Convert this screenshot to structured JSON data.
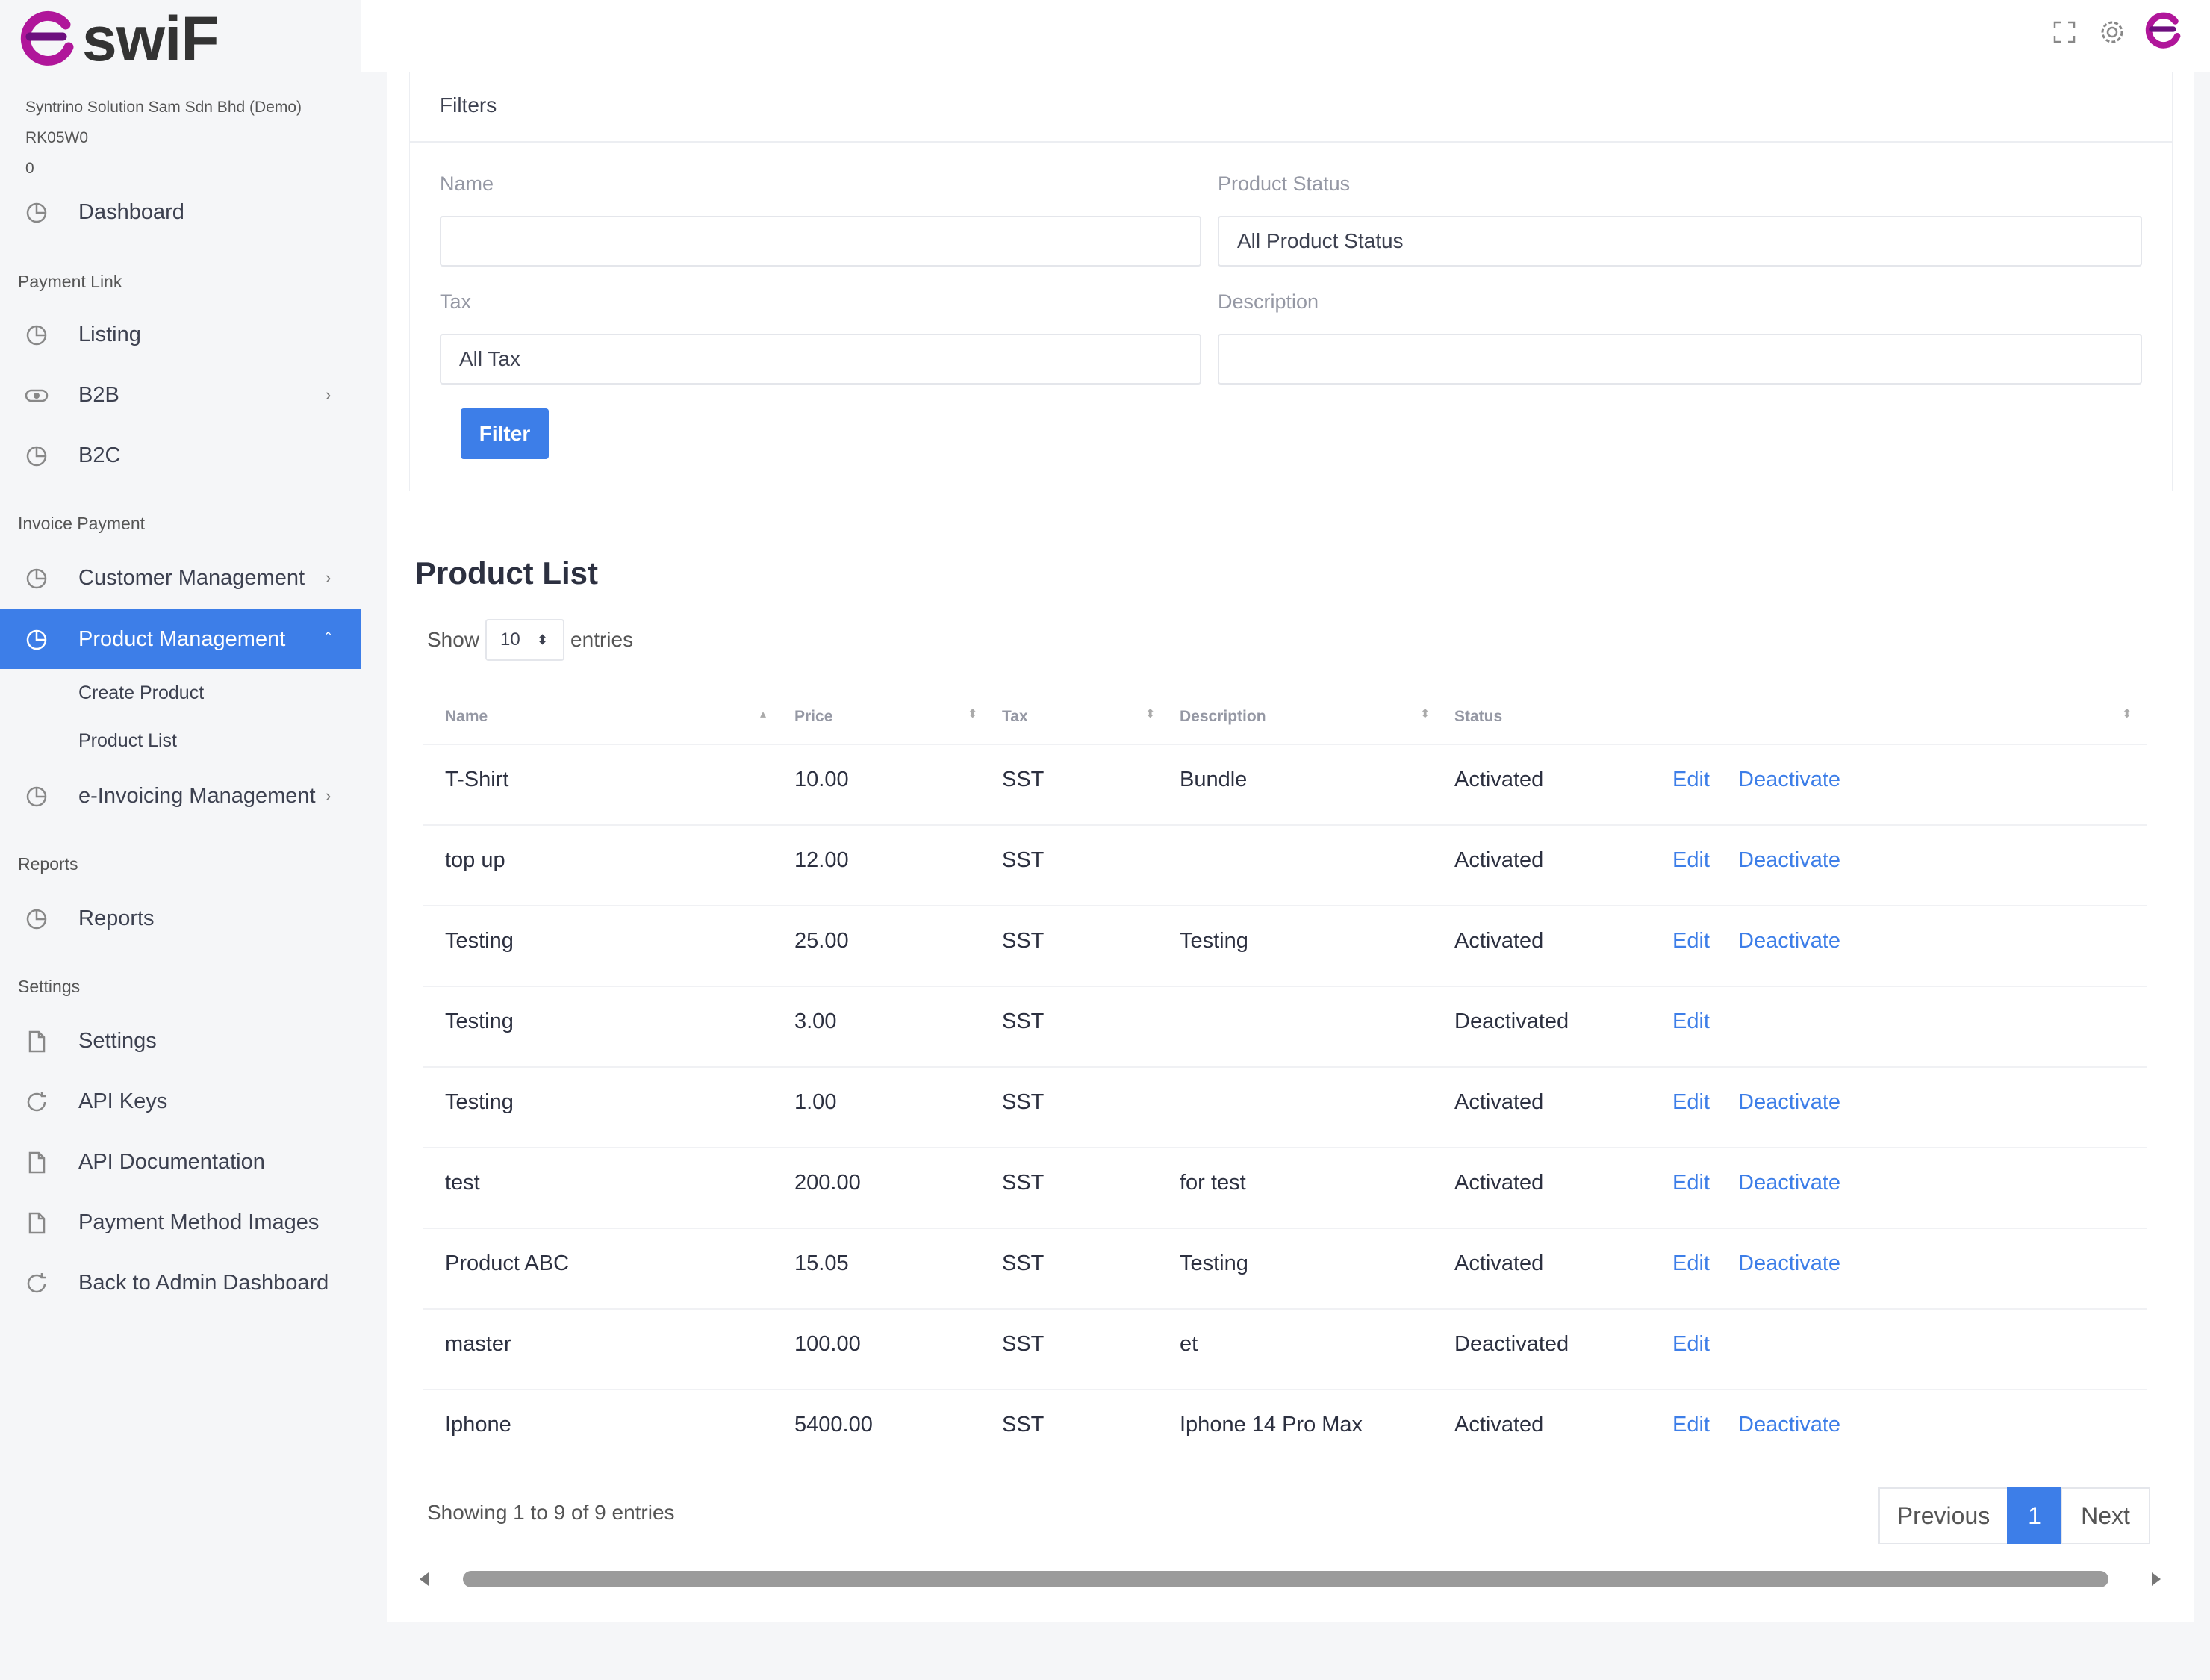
{
  "brand": {
    "name": "swiF",
    "accent": "#3d7ee8",
    "logo_color": "#b0169a"
  },
  "company": {
    "name": "Syntrino Solution Sam Sdn Bhd (Demo)",
    "code": "RK05W0",
    "balance": "0"
  },
  "sidebar": {
    "dashboard": "Dashboard",
    "sections": {
      "payment_link": "Payment Link",
      "invoice_payment": "Invoice Payment",
      "reports": "Reports",
      "settings": "Settings"
    },
    "items": {
      "listing": "Listing",
      "b2b": "B2B",
      "b2c": "B2C",
      "customer_management": "Customer Management",
      "product_management": "Product Management",
      "create_product": "Create Product",
      "product_list": "Product List",
      "einvoicing": "e-Invoicing Management",
      "reports": "Reports",
      "settings": "Settings",
      "api_keys": "API Keys",
      "api_docs": "API Documentation",
      "payment_images": "Payment Method Images",
      "back_admin": "Back to Admin Dashboard"
    }
  },
  "filters": {
    "title": "Filters",
    "name_label": "Name",
    "name_value": "",
    "status_label": "Product Status",
    "status_value": "All Product Status",
    "tax_label": "Tax",
    "tax_value": "All Tax",
    "description_label": "Description",
    "description_value": "",
    "button": "Filter"
  },
  "list": {
    "title": "Product List",
    "show_label": "Show",
    "page_length": "10",
    "entries_label": "entries",
    "columns": {
      "name": "Name",
      "price": "Price",
      "tax": "Tax",
      "description": "Description",
      "status": "Status"
    },
    "rows": [
      {
        "name": "T-Shirt",
        "price": "10.00",
        "tax": "SST",
        "description": "Bundle",
        "status": "Activated",
        "edit": "Edit",
        "deactivate": "Deactivate"
      },
      {
        "name": "top up",
        "price": "12.00",
        "tax": "SST",
        "description": "",
        "status": "Activated",
        "edit": "Edit",
        "deactivate": "Deactivate"
      },
      {
        "name": "Testing",
        "price": "25.00",
        "tax": "SST",
        "description": "Testing",
        "status": "Activated",
        "edit": "Edit",
        "deactivate": "Deactivate"
      },
      {
        "name": "Testing",
        "price": "3.00",
        "tax": "SST",
        "description": "",
        "status": "Deactivated",
        "edit": "Edit",
        "deactivate": ""
      },
      {
        "name": "Testing",
        "price": "1.00",
        "tax": "SST",
        "description": "",
        "status": "Activated",
        "edit": "Edit",
        "deactivate": "Deactivate"
      },
      {
        "name": "test",
        "price": "200.00",
        "tax": "SST",
        "description": "for test",
        "status": "Activated",
        "edit": "Edit",
        "deactivate": "Deactivate"
      },
      {
        "name": "Product ABC",
        "price": "15.05",
        "tax": "SST",
        "description": "Testing",
        "status": "Activated",
        "edit": "Edit",
        "deactivate": "Deactivate"
      },
      {
        "name": "master",
        "price": "100.00",
        "tax": "SST",
        "description": "et",
        "status": "Deactivated",
        "edit": "Edit",
        "deactivate": ""
      },
      {
        "name": "Iphone",
        "price": "5400.00",
        "tax": "SST",
        "description": "Iphone 14 Pro Max",
        "status": "Activated",
        "edit": "Edit",
        "deactivate": "Deactivate"
      }
    ],
    "info": "Showing 1 to 9 of 9 entries",
    "pagination": {
      "previous": "Previous",
      "current": "1",
      "next": "Next"
    }
  },
  "icons": {
    "expand": "expand-icon",
    "settings": "gear-icon",
    "profile": "swif-logo-icon",
    "nav": "pie-chart-icon"
  }
}
